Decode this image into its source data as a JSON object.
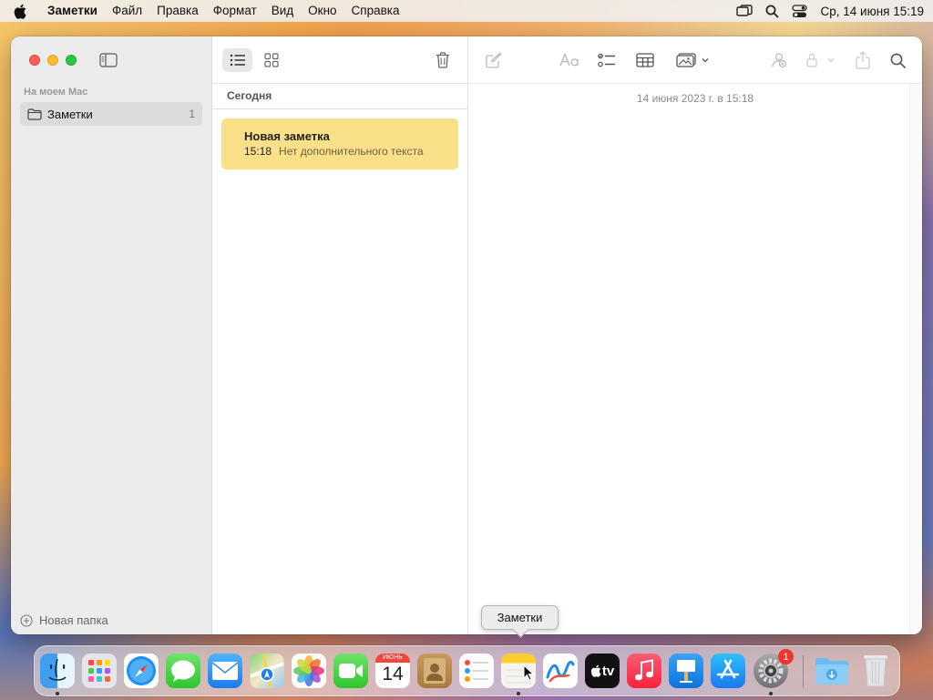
{
  "menubar": {
    "app_name": "Заметки",
    "items": [
      "Файл",
      "Правка",
      "Формат",
      "Вид",
      "Окно",
      "Справка"
    ],
    "clock": "Ср, 14 июня  15:19"
  },
  "sidebar": {
    "section_title": "На моем Mac",
    "folder": {
      "name": "Заметки",
      "count": "1"
    },
    "new_folder_label": "Новая папка"
  },
  "notes_list": {
    "group_header": "Сегодня",
    "notes": [
      {
        "title": "Новая заметка",
        "time": "15:18",
        "preview": "Нет дополнительного текста"
      }
    ]
  },
  "editor": {
    "note_date": "14 июня 2023 г. в 15:18"
  },
  "tooltip": {
    "text": "Заметки"
  },
  "dock": {
    "apps": [
      "Finder",
      "Launchpad",
      "Safari",
      "Сообщения",
      "Почта",
      "Карты",
      "Фото",
      "FaceTime",
      "Календарь",
      "Контакты",
      "Напоминания",
      "Заметки",
      "Freeform",
      "TV",
      "Музыка",
      "Keynote",
      "App Store",
      "Системные настройки",
      "Загрузки",
      "Корзина"
    ],
    "calendar_month": "ИЮНЬ",
    "calendar_day": "14",
    "settings_badge": "1",
    "tv_label": "tv"
  },
  "colors": {
    "note_highlight": "#fbe08a",
    "traffic_red": "#fe5f57",
    "traffic_yellow": "#febc2e",
    "traffic_green": "#28c840"
  }
}
